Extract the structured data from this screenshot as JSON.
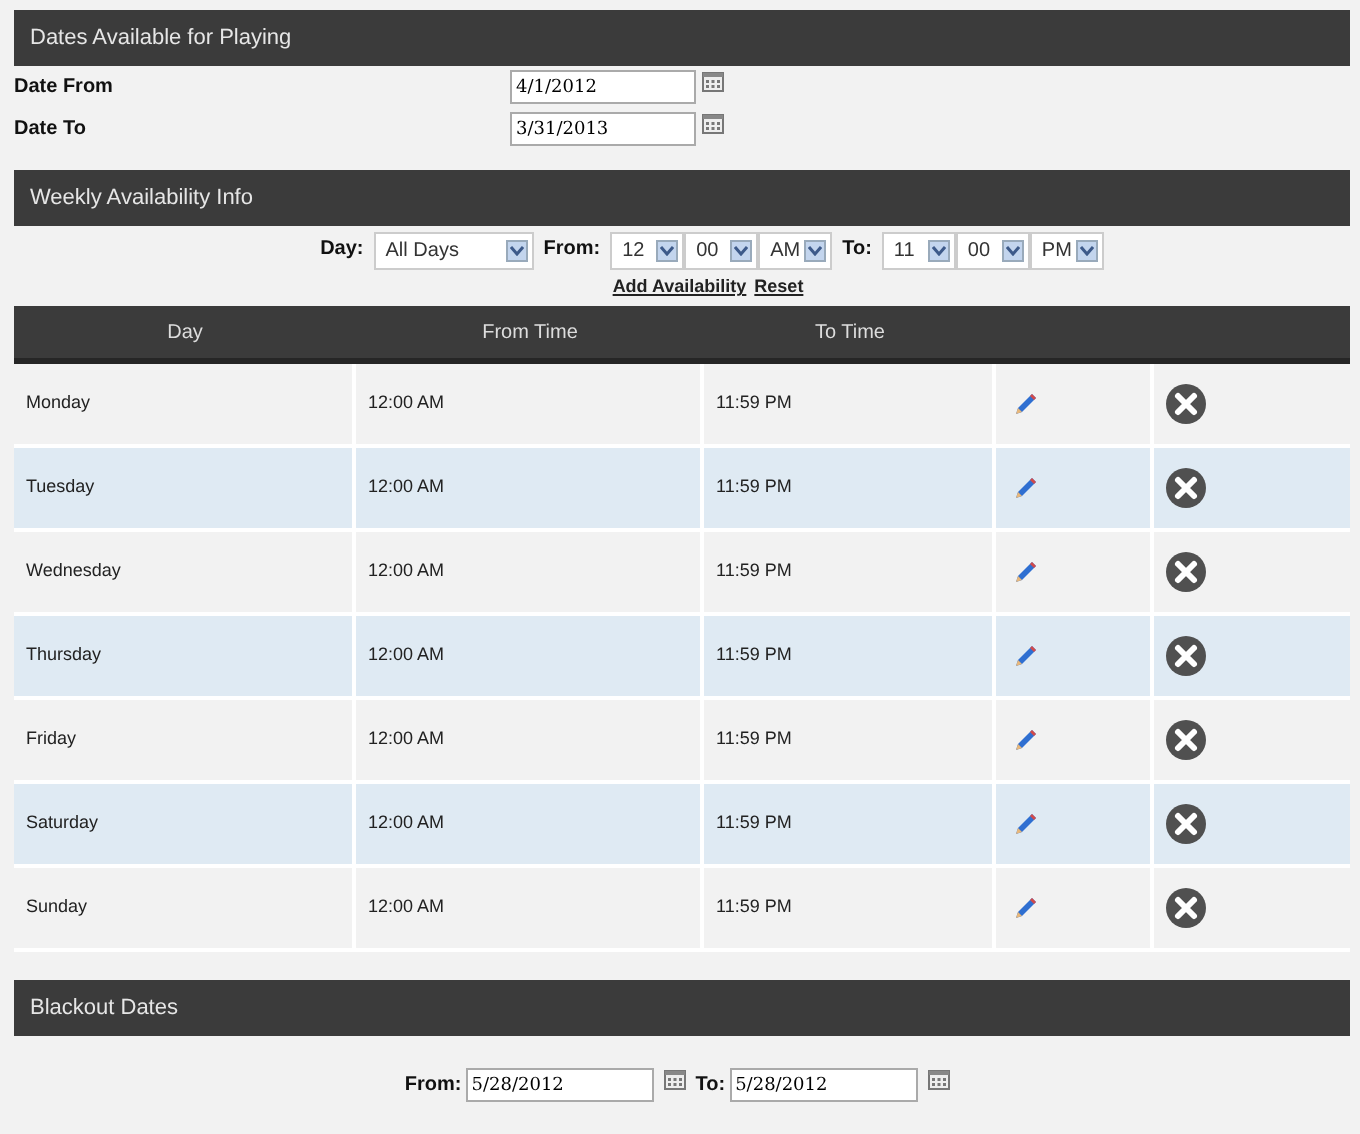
{
  "dates_section": {
    "title": "Dates Available for Playing",
    "fields": [
      {
        "label": "Date From",
        "value": "4/1/2012"
      },
      {
        "label": "Date To",
        "value": "3/31/2013"
      }
    ]
  },
  "weekly_section": {
    "title": "Weekly Availability Info",
    "filter": {
      "day_label": "Day:",
      "day": "All Days",
      "from_label": "From:",
      "from_hour": "12",
      "from_minute": "00",
      "from_period": "AM",
      "to_label": "To:",
      "to_hour": "11",
      "to_minute": "00",
      "to_period": "PM"
    },
    "links": [
      "Add Availability",
      "Reset"
    ],
    "table": {
      "columns": [
        "Day",
        "From Time",
        "To Time"
      ],
      "rows": [
        {
          "day": "Monday",
          "from": "12:00 AM",
          "to": "11:59 PM"
        },
        {
          "day": "Tuesday",
          "from": "12:00 AM",
          "to": "11:59 PM"
        },
        {
          "day": "Wednesday",
          "from": "12:00 AM",
          "to": "11:59 PM"
        },
        {
          "day": "Thursday",
          "from": "12:00 AM",
          "to": "11:59 PM"
        },
        {
          "day": "Friday",
          "from": "12:00 AM",
          "to": "11:59 PM"
        },
        {
          "day": "Saturday",
          "from": "12:00 AM",
          "to": "11:59 PM"
        },
        {
          "day": "Sunday",
          "from": "12:00 AM",
          "to": "11:59 PM"
        }
      ]
    }
  },
  "blackout_section": {
    "title": "Blackout Dates",
    "from_label": "From:",
    "from": "5/28/2012",
    "to_label": "To:",
    "to": "5/28/2012"
  }
}
